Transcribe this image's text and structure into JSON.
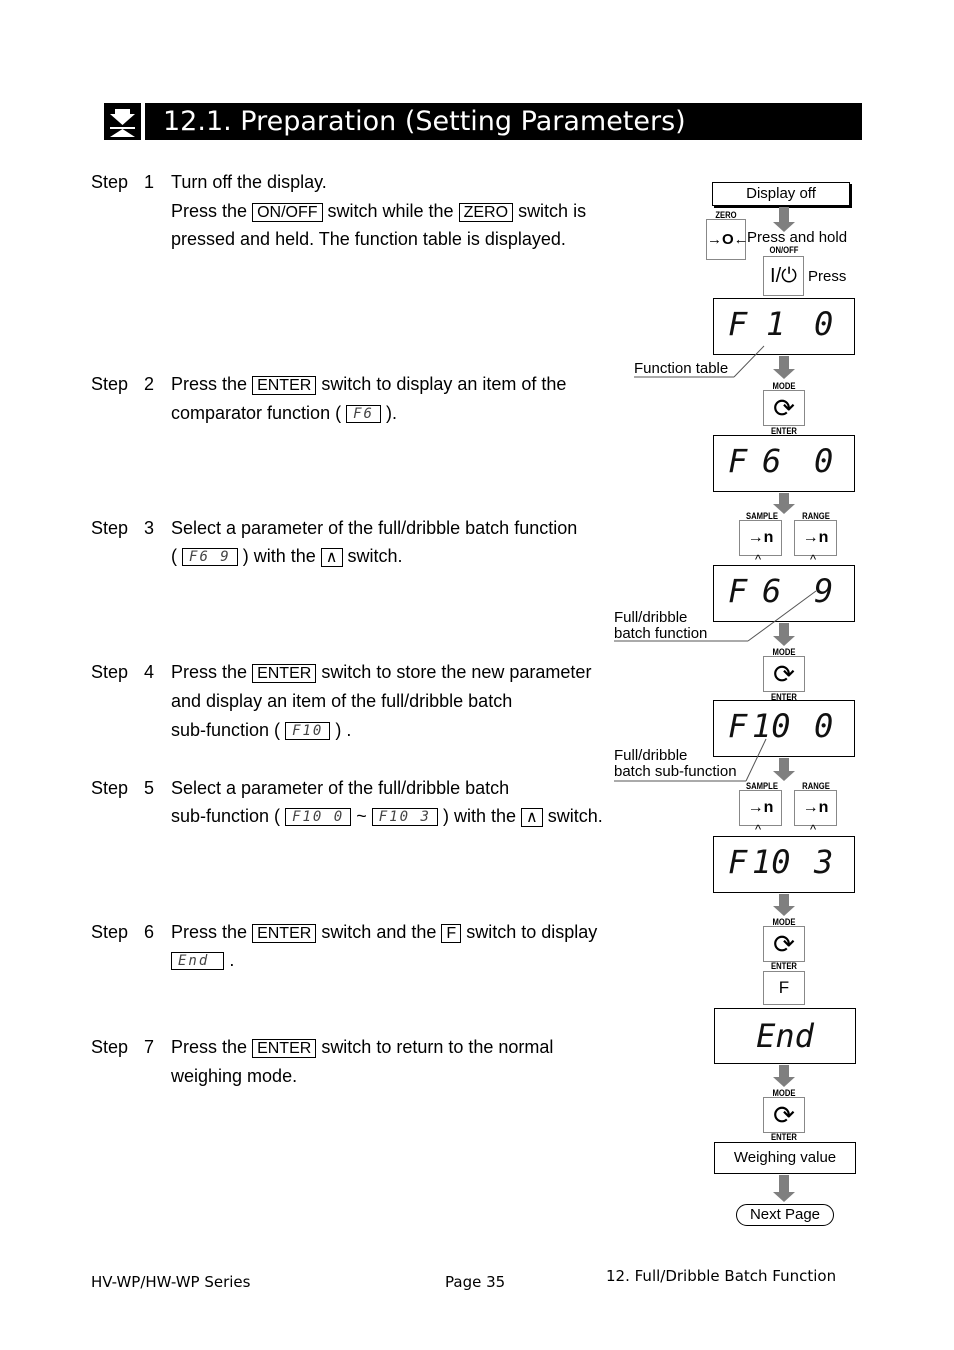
{
  "header": {
    "icon": "weighing-icon",
    "title": "12.1.  Preparation (Setting Parameters)"
  },
  "steps": [
    {
      "label": "Step",
      "num": "1",
      "lines": [
        "Turn off the display."
      ],
      "l2_a": "Press the",
      "l2_key1": "ON/OFF",
      "l2_b": "switch while the",
      "l2_key2": "ZERO",
      "l2_c": "switch is",
      "l3": "pressed and held. The function table is displayed."
    },
    {
      "label": "Step",
      "num": "2",
      "l1_a": "Press the",
      "l1_key": "ENTER",
      "l1_b": "switch to display an item of the",
      "l2_a": "comparator function (",
      "l2_seg": "F6",
      "l2_b": ")."
    },
    {
      "label": "Step",
      "num": "3",
      "l1": "Select a parameter of the full/dribble batch function",
      "l2_a": "(",
      "l2_seg": "F6 9",
      "l2_b": ") with the",
      "l2_key": "∧",
      "l2_c": "switch."
    },
    {
      "label": "Step",
      "num": "4",
      "l1_a": "Press the",
      "l1_key": "ENTER",
      "l1_b": "switch to store the new parameter",
      "l2": "and display an item of the full/dribble batch",
      "l3_a": "sub-function (",
      "l3_seg": "F10",
      "l3_b": ") ."
    },
    {
      "label": "Step",
      "num": "5",
      "l1": "Select a parameter of the full/dribble batch",
      "l2_a": "sub-function (",
      "l2_seg1": "F10 0",
      "l2_tilde": "~",
      "l2_seg2": "F10 3",
      "l2_b": ") with the",
      "l2_key": "∧",
      "l2_c": "switch."
    },
    {
      "label": "Step",
      "num": "6",
      "l1_a": "Press the",
      "l1_key1": "ENTER",
      "l1_b": "switch and the",
      "l1_key2": "F",
      "l1_c": "switch to display",
      "l2_seg": "End",
      "l2_b": "."
    },
    {
      "label": "Step",
      "num": "7",
      "l1_a": "Press the",
      "l1_key": "ENTER",
      "l1_b": "switch to return to the normal",
      "l2": "weighing mode."
    }
  ],
  "flow": {
    "display_off": "Display off",
    "zero_cap": "ZERO",
    "zero_glyph": "→O←",
    "press_hold": "Press and hold",
    "onoff_cap": "ON/OFF",
    "onoff_glyph": "I/⏻",
    "press": "Press",
    "lcd1": {
      "a": "F",
      "b": "1",
      "c": "0"
    },
    "note_function_table": "Function table",
    "mode_cap": "MODE",
    "enter_cap": "ENTER",
    "mode_glyph": "⟳",
    "lcd2": {
      "a": "F",
      "b": "6",
      "c": "0"
    },
    "sample_cap": "SAMPLE",
    "range_cap": "RANGE",
    "sample_glyph": "→n",
    "up_caret": "^",
    "lcd3": {
      "a": "F",
      "b": "6",
      "c": "9"
    },
    "note_batch_function": [
      "Full/dribble",
      "batch function"
    ],
    "lcd4": {
      "a": "F",
      "b": "10",
      "c": "0"
    },
    "note_batch_sub": [
      "Full/dribble",
      "batch sub-function"
    ],
    "lcd5": {
      "a": "F",
      "b": "10",
      "c": "3"
    },
    "f_key": "F",
    "lcd6": "End",
    "weighing_value": "Weighing value",
    "next_page": "Next Page"
  },
  "footer": {
    "series": "HV-WP/HW-WP Series",
    "page": "Page 35",
    "section": "12. Full/Dribble Batch Function"
  }
}
